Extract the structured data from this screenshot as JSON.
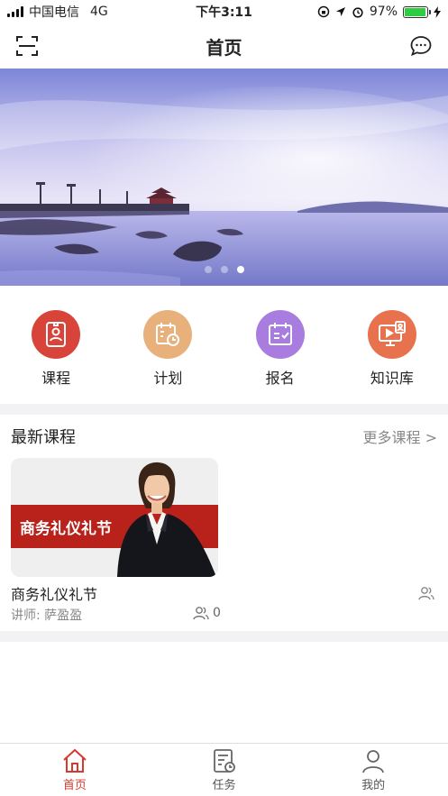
{
  "status_bar": {
    "carrier": "中国电信",
    "network": "4G",
    "time": "下午3:11",
    "battery": "97%",
    "battery_level": 0.97
  },
  "nav": {
    "title": "首页",
    "left_icon": "scan-icon",
    "right_icon": "message-icon"
  },
  "banner": {
    "slide_count": 3,
    "active_slide": 3
  },
  "menu": [
    {
      "label": "课程",
      "icon": "course-icon",
      "color": "#d9443a"
    },
    {
      "label": "计划",
      "icon": "plan-icon",
      "color": "#e8b07a"
    },
    {
      "label": "报名",
      "icon": "signup-icon",
      "color": "#a97de0"
    },
    {
      "label": "知识库",
      "icon": "knowledge-icon",
      "color": "#e8714e"
    }
  ],
  "latest": {
    "title": "最新课程",
    "more": "更多课程 >",
    "course": {
      "cover_text": "商务礼仪礼节",
      "name": "商务礼仪礼节",
      "teacher": "讲师:  萨盈盈",
      "count": "0"
    }
  },
  "tabs": [
    {
      "label": "首页",
      "icon": "home-icon",
      "active": true
    },
    {
      "label": "任务",
      "icon": "task-icon",
      "active": false
    },
    {
      "label": "我的",
      "icon": "user-icon",
      "active": false
    }
  ],
  "colors": {
    "accent": "#d63a2f"
  }
}
